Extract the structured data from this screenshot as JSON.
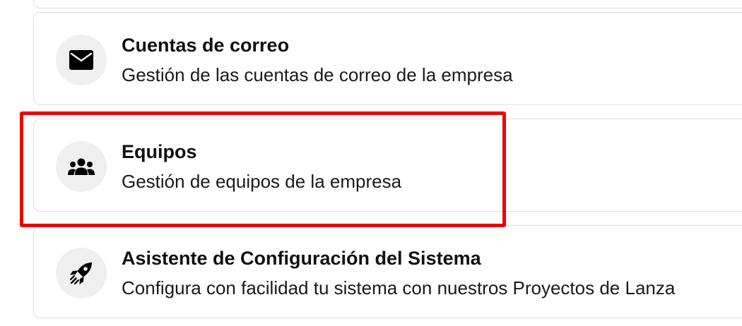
{
  "items": [
    {
      "title": "Cuentas de correo",
      "description": "Gestión de las cuentas de correo de la empresa",
      "icon": "mail-icon"
    },
    {
      "title": "Equipos",
      "description": "Gestión de equipos de la empresa",
      "icon": "team-icon"
    },
    {
      "title": "Asistente de Configuración del Sistema",
      "description": "Configura con facilidad tu sistema con nuestros Proyectos de Lanza",
      "icon": "rocket-icon"
    }
  ],
  "colors": {
    "highlight": "#ee0000",
    "card_border": "#dedede",
    "icon_background": "#efefef",
    "text": "#111111"
  }
}
